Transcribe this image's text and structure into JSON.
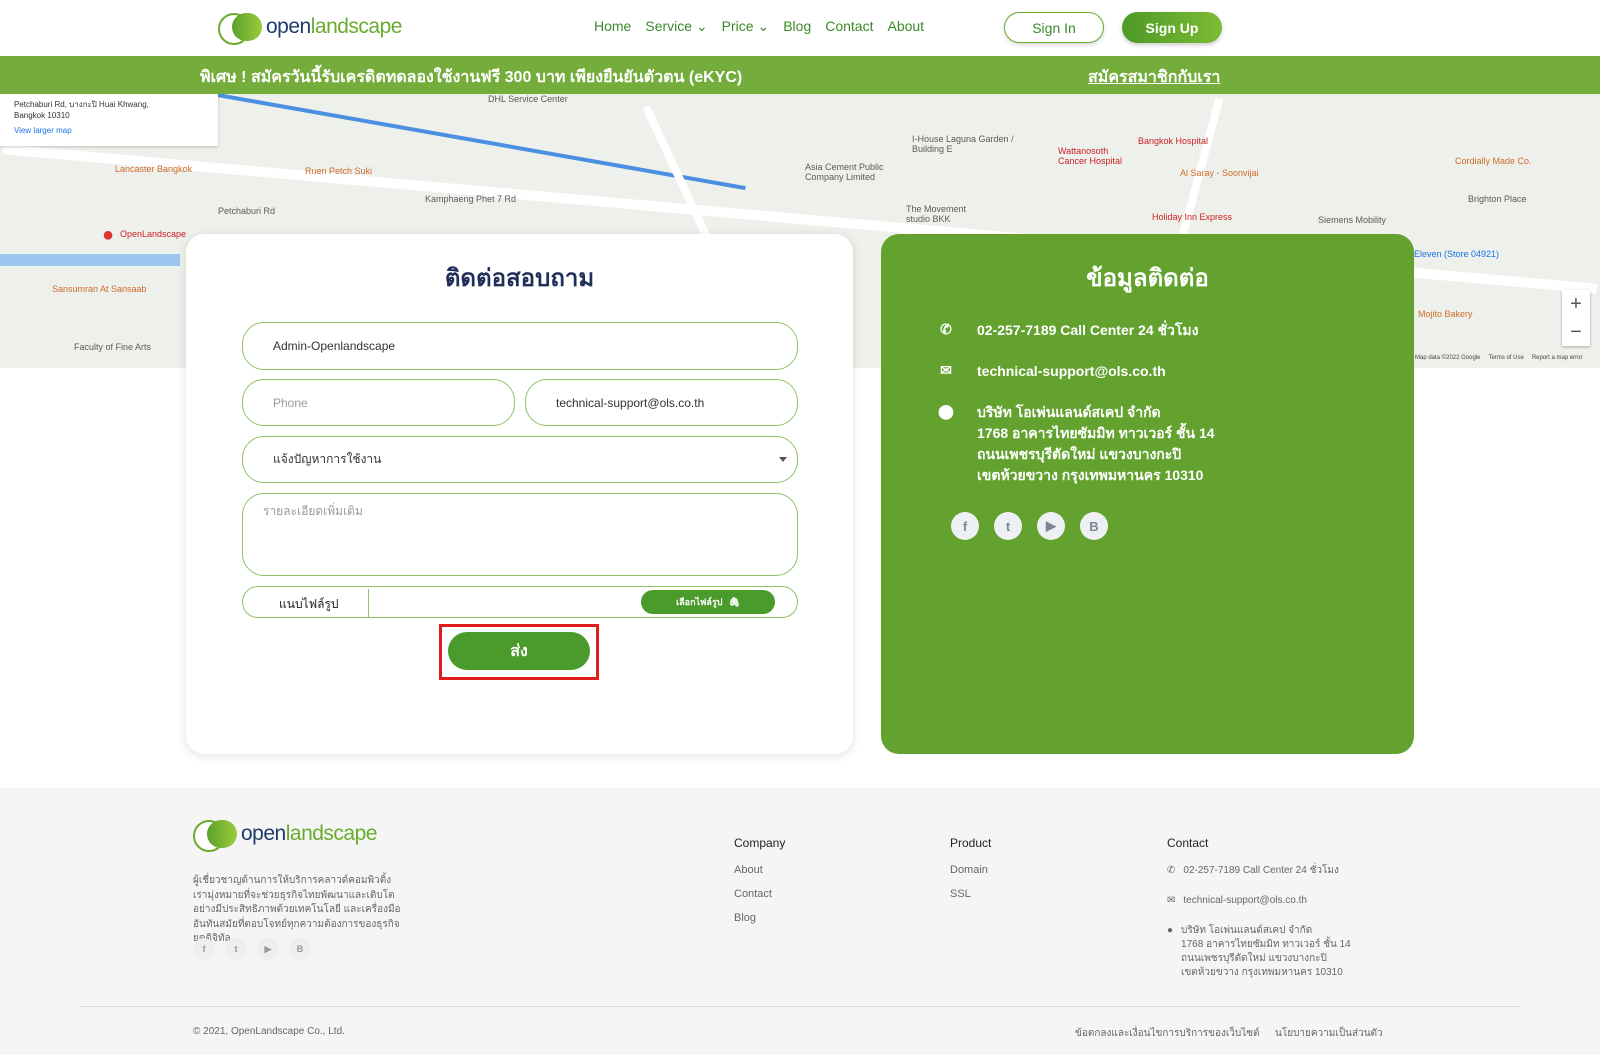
{
  "nav": {
    "logo": {
      "brand_a": "open",
      "brand_b": "landscape"
    },
    "items": [
      "Home",
      "Service",
      "Price",
      "Blog",
      "Contact",
      "About"
    ],
    "sign_in": "Sign In",
    "sign_up": "Sign Up"
  },
  "promo": {
    "text": "พิเศษ ! สมัครวันนี้รับเครดิตทดลองใช้งานฟรี 300 บาท เพียงยืนยันตัวตน (eKYC)",
    "link": "สมัครสมาชิกกับเรา"
  },
  "map": {
    "address": "Petchaburi Rd, บางกะปิ Huai Khwang, Bangkok 10310",
    "larger_map": "View larger map",
    "labels": [
      "Lancaster Bangkok",
      "OpenLandscape",
      "Petchaburi Rd",
      "Ruen Petch Suki",
      "Kamphaeng Phet 7 Rd",
      "Asia Cement Public Company Limited",
      "Bangkok Hospital",
      "Wattanosoth Cancer Hospital",
      "Al Saray - Soonvijai",
      "Holiday Inn Express",
      "The Movement studio BKK",
      "Siemens Mobility",
      "Brighton Place",
      "Cordially Made Co.",
      "Mojito Bakery",
      "Sansumran At Sansaab",
      "Faculty of Fine Arts",
      "DHL Service Center",
      "I-House Laguna Garden / Building E",
      "Eleven (Store 04921)"
    ],
    "footer": "Map data ©2022 Google",
    "terms": "Terms of Use",
    "report": "Report a map error"
  },
  "form": {
    "title": "ติดต่อสอบถาม",
    "name_value": "Admin-Openlandscape",
    "phone_placeholder": "Phone",
    "email_value": "technical-support@ols.co.th",
    "topic_value": "แจ้งปัญหาการใช้งาน",
    "details_placeholder": "รายละเอียดเพิ่มเติม",
    "attach_label": "แนบไฟล์รูป",
    "choose_file": "เลือกไฟล์รูป",
    "submit": "ส่ง"
  },
  "contact": {
    "title": "ข้อมูลติดต่อ",
    "phone": "02-257-7189 Call Center 24 ชั่วโมง",
    "email": "technical-support@ols.co.th",
    "address": [
      "บริษัท โอเพ่นแลนด์สเคป จำกัด",
      "1768 อาคารไทยซัมมิท ทาวเวอร์ ชั้น 14",
      "ถนนเพชรบุรีตัดใหม่ แขวงบางกะปิ",
      "เขตห้วยขวาง กรุงเทพมหานคร 10310"
    ],
    "socials": [
      "facebook",
      "twitter",
      "youtube",
      "blogger"
    ]
  },
  "footer": {
    "description": "ผู้เชี่ยวชาญด้านการให้บริการคลาวด์คอมพิวติ้ง เรามุ่งหมายที่จะช่วยธุรกิจไทยพัฒนาและเติบโตอย่างมีประสิทธิภาพด้วยเทคโนโลยี และเครื่องมืออันทันสมัยที่ตอบโจทย์ทุกความต้องการของธุรกิจยุคดิจิทัล",
    "company": {
      "title": "Company",
      "items": [
        "About",
        "Contact",
        "Blog"
      ]
    },
    "product": {
      "title": "Product",
      "items": [
        "Domain",
        "SSL"
      ]
    },
    "contact": {
      "title": "Contact",
      "phone": "02-257-7189 Call Center 24 ชั่วโมง",
      "email": "technical-support@ols.co.th",
      "address": [
        "บริษัท โอเพ่นแลนด์สเคป จำกัด",
        "1768 อาคารไทยซัมมิท ทาวเวอร์ ชั้น 14",
        "ถนนเพชรบุรีตัดใหม่ แขวงบางกะปิ",
        "เขตห้วยขวาง กรุงเทพมหานคร 10310"
      ]
    },
    "copyright": "© 2021, OpenLandscape Co., Ltd.",
    "terms": "ข้อตกลงและเงื่อนไขการบริการของเว็บไซต์",
    "privacy": "นโยบายความเป็นส่วนตัว"
  },
  "colors": {
    "brand_green": "#63a22f",
    "button_green": "#4b9a2c",
    "highlight": "#e01c1c",
    "navy": "#1f2f5a"
  }
}
